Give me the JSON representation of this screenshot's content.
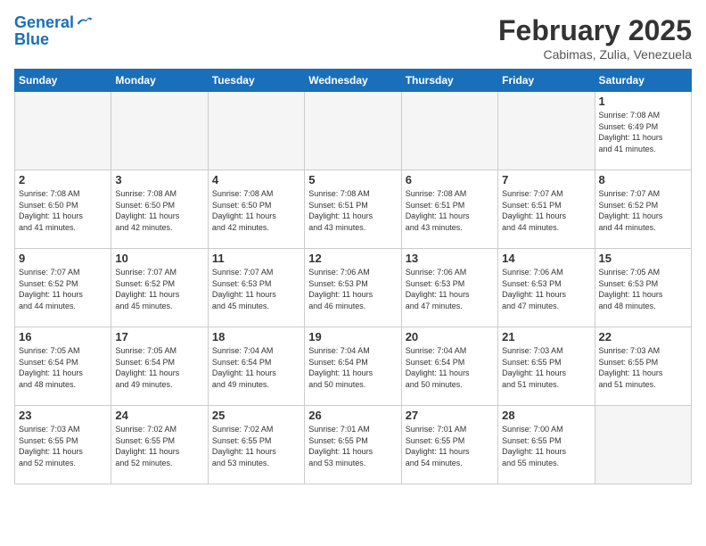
{
  "header": {
    "logo_line1": "General",
    "logo_line2": "Blue",
    "month_year": "February 2025",
    "subtitle": "Cabimas, Zulia, Venezuela"
  },
  "days_of_week": [
    "Sunday",
    "Monday",
    "Tuesday",
    "Wednesday",
    "Thursday",
    "Friday",
    "Saturday"
  ],
  "weeks": [
    [
      {
        "day": "",
        "info": ""
      },
      {
        "day": "",
        "info": ""
      },
      {
        "day": "",
        "info": ""
      },
      {
        "day": "",
        "info": ""
      },
      {
        "day": "",
        "info": ""
      },
      {
        "day": "",
        "info": ""
      },
      {
        "day": "1",
        "info": "Sunrise: 7:08 AM\nSunset: 6:49 PM\nDaylight: 11 hours\nand 41 minutes."
      }
    ],
    [
      {
        "day": "2",
        "info": "Sunrise: 7:08 AM\nSunset: 6:50 PM\nDaylight: 11 hours\nand 41 minutes."
      },
      {
        "day": "3",
        "info": "Sunrise: 7:08 AM\nSunset: 6:50 PM\nDaylight: 11 hours\nand 42 minutes."
      },
      {
        "day": "4",
        "info": "Sunrise: 7:08 AM\nSunset: 6:50 PM\nDaylight: 11 hours\nand 42 minutes."
      },
      {
        "day": "5",
        "info": "Sunrise: 7:08 AM\nSunset: 6:51 PM\nDaylight: 11 hours\nand 43 minutes."
      },
      {
        "day": "6",
        "info": "Sunrise: 7:08 AM\nSunset: 6:51 PM\nDaylight: 11 hours\nand 43 minutes."
      },
      {
        "day": "7",
        "info": "Sunrise: 7:07 AM\nSunset: 6:51 PM\nDaylight: 11 hours\nand 44 minutes."
      },
      {
        "day": "8",
        "info": "Sunrise: 7:07 AM\nSunset: 6:52 PM\nDaylight: 11 hours\nand 44 minutes."
      }
    ],
    [
      {
        "day": "9",
        "info": "Sunrise: 7:07 AM\nSunset: 6:52 PM\nDaylight: 11 hours\nand 44 minutes."
      },
      {
        "day": "10",
        "info": "Sunrise: 7:07 AM\nSunset: 6:52 PM\nDaylight: 11 hours\nand 45 minutes."
      },
      {
        "day": "11",
        "info": "Sunrise: 7:07 AM\nSunset: 6:53 PM\nDaylight: 11 hours\nand 45 minutes."
      },
      {
        "day": "12",
        "info": "Sunrise: 7:06 AM\nSunset: 6:53 PM\nDaylight: 11 hours\nand 46 minutes."
      },
      {
        "day": "13",
        "info": "Sunrise: 7:06 AM\nSunset: 6:53 PM\nDaylight: 11 hours\nand 47 minutes."
      },
      {
        "day": "14",
        "info": "Sunrise: 7:06 AM\nSunset: 6:53 PM\nDaylight: 11 hours\nand 47 minutes."
      },
      {
        "day": "15",
        "info": "Sunrise: 7:05 AM\nSunset: 6:53 PM\nDaylight: 11 hours\nand 48 minutes."
      }
    ],
    [
      {
        "day": "16",
        "info": "Sunrise: 7:05 AM\nSunset: 6:54 PM\nDaylight: 11 hours\nand 48 minutes."
      },
      {
        "day": "17",
        "info": "Sunrise: 7:05 AM\nSunset: 6:54 PM\nDaylight: 11 hours\nand 49 minutes."
      },
      {
        "day": "18",
        "info": "Sunrise: 7:04 AM\nSunset: 6:54 PM\nDaylight: 11 hours\nand 49 minutes."
      },
      {
        "day": "19",
        "info": "Sunrise: 7:04 AM\nSunset: 6:54 PM\nDaylight: 11 hours\nand 50 minutes."
      },
      {
        "day": "20",
        "info": "Sunrise: 7:04 AM\nSunset: 6:54 PM\nDaylight: 11 hours\nand 50 minutes."
      },
      {
        "day": "21",
        "info": "Sunrise: 7:03 AM\nSunset: 6:55 PM\nDaylight: 11 hours\nand 51 minutes."
      },
      {
        "day": "22",
        "info": "Sunrise: 7:03 AM\nSunset: 6:55 PM\nDaylight: 11 hours\nand 51 minutes."
      }
    ],
    [
      {
        "day": "23",
        "info": "Sunrise: 7:03 AM\nSunset: 6:55 PM\nDaylight: 11 hours\nand 52 minutes."
      },
      {
        "day": "24",
        "info": "Sunrise: 7:02 AM\nSunset: 6:55 PM\nDaylight: 11 hours\nand 52 minutes."
      },
      {
        "day": "25",
        "info": "Sunrise: 7:02 AM\nSunset: 6:55 PM\nDaylight: 11 hours\nand 53 minutes."
      },
      {
        "day": "26",
        "info": "Sunrise: 7:01 AM\nSunset: 6:55 PM\nDaylight: 11 hours\nand 53 minutes."
      },
      {
        "day": "27",
        "info": "Sunrise: 7:01 AM\nSunset: 6:55 PM\nDaylight: 11 hours\nand 54 minutes."
      },
      {
        "day": "28",
        "info": "Sunrise: 7:00 AM\nSunset: 6:55 PM\nDaylight: 11 hours\nand 55 minutes."
      },
      {
        "day": "",
        "info": ""
      }
    ]
  ]
}
